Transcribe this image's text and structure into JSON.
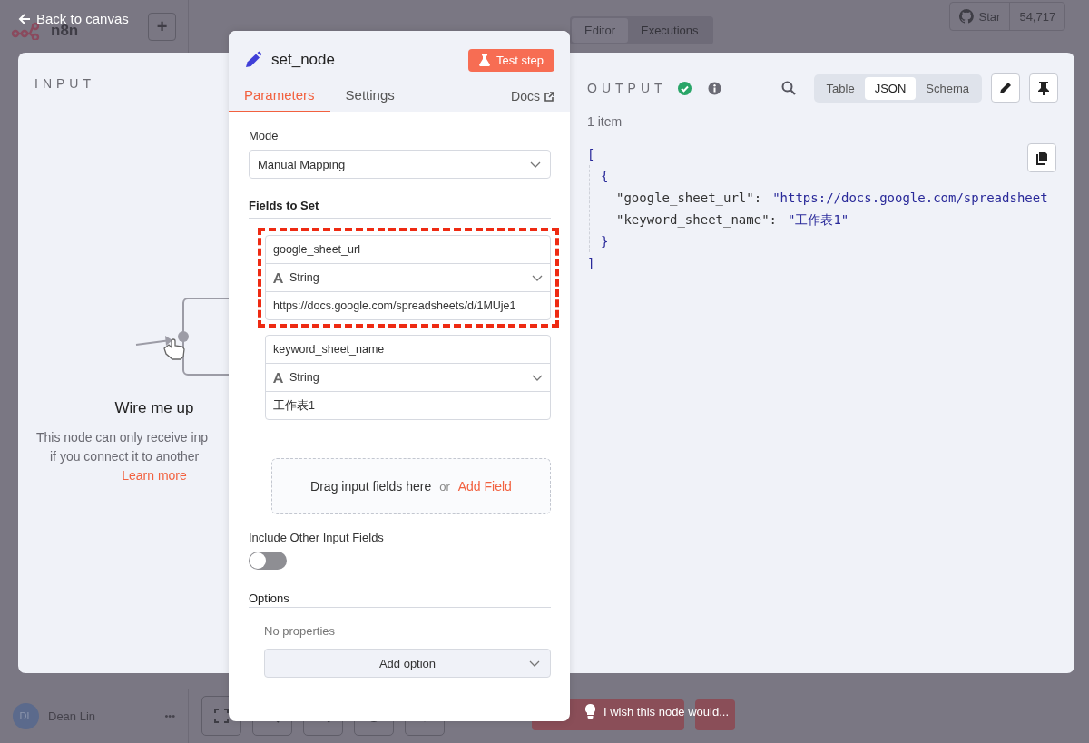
{
  "canvas": {
    "logo": "n8n",
    "add_button": "+",
    "tabs": [
      {
        "label": "Editor",
        "selected": true
      },
      {
        "label": "Executions",
        "selected": false
      }
    ],
    "star": {
      "label": "Star",
      "count": "54,717"
    },
    "user": {
      "initials": "DL",
      "name": "Dean Lin",
      "menu": "•••"
    },
    "hint": "I wish this node would..."
  },
  "back_link": "Back to canvas",
  "input_panel": {
    "title": "INPUT",
    "heading": "Wire me up",
    "message_lines": [
      "This node can only receive inp",
      "if you connect it to another"
    ],
    "link": "Learn more"
  },
  "node_panel": {
    "title": "set_node",
    "test_button": "Test step",
    "tabs": [
      {
        "label": "Parameters",
        "selected": true
      },
      {
        "label": "Settings",
        "selected": false
      }
    ],
    "docs_link": "Docs",
    "mode": {
      "label": "Mode",
      "value": "Manual Mapping"
    },
    "fields_section": "Fields to Set",
    "fields": [
      {
        "name": "google_sheet_url",
        "type": "String",
        "value": "https://docs.google.com/spreadsheets/d/1MUje1",
        "highlighted": true
      },
      {
        "name": "keyword_sheet_name",
        "type": "String",
        "value": "工作表1",
        "highlighted": false
      }
    ],
    "drop_zone": {
      "text": "Drag input fields here",
      "or": "or",
      "link": "Add Field"
    },
    "include_other_fields": {
      "label": "Include Other Input Fields",
      "on": false
    },
    "options": {
      "heading": "Options",
      "empty": "No properties",
      "add": "Add option"
    }
  },
  "output_panel": {
    "title": "OUTPUT",
    "success": true,
    "views": [
      {
        "label": "Table",
        "selected": false
      },
      {
        "label": "JSON",
        "selected": true
      },
      {
        "label": "Schema",
        "selected": false
      }
    ],
    "count": "1 item",
    "json": {
      "open": "[",
      "obj_open": "{",
      "entries": [
        {
          "key": "\"google_sheet_url\":",
          "value": "\"https://docs.google.com/spreadsheet"
        },
        {
          "key": "\"keyword_sheet_name\":",
          "value": "\"工作表1\""
        }
      ],
      "obj_close": "}",
      "close": "]"
    }
  }
}
